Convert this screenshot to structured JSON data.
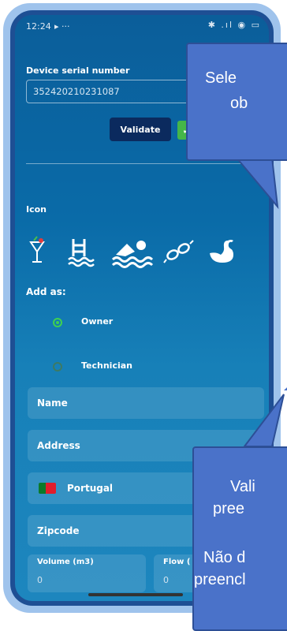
{
  "status": {
    "time": "12:24",
    "left_icons": "▸ ···",
    "right_icons": "✱ .ıl ◉ ▭"
  },
  "form": {
    "serial_label": "Device serial number",
    "serial_value": "352420210231087",
    "validate_label": "Validate",
    "check_glyph": "✓",
    "icon_label": "Icon",
    "icons": [
      "cocktail-icon",
      "pool-ladder-icon",
      "swimmer-icon",
      "goggles-icon",
      "swan-float-icon"
    ],
    "add_as_label": "Add as:",
    "roles": [
      {
        "label": "Owner",
        "selected": true
      },
      {
        "label": "Technician",
        "selected": false
      }
    ],
    "name_label": "Name",
    "address_label": "Address",
    "country_label": "Portugal",
    "zipcode_label": "Zipcode",
    "volume_label": "Volume (m3)",
    "volume_value": "0",
    "flow_label": "Flow (",
    "flow_value": "0"
  },
  "callouts": {
    "top_lines": [
      "Sele",
      "ob"
    ],
    "bottom_lines": [
      "Vali",
      "pree",
      "",
      "Não d",
      "preencl"
    ]
  },
  "colors": {
    "accent_green": "#45b649",
    "button_dark": "#0b2a5e",
    "callout_blue": "#4a72c9"
  }
}
